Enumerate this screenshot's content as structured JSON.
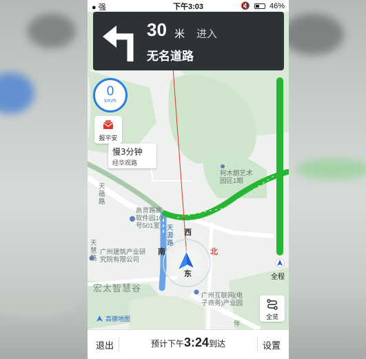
{
  "status_bar": {
    "signal": "强",
    "time": "下午3:03",
    "battery": "46%",
    "battery_level": 0.46
  },
  "guidance": {
    "distance": "30",
    "unit": "米",
    "action": "进入",
    "road": "无名道路",
    "turn_icon": "turn-left-arrow-icon"
  },
  "speed": {
    "value": "0",
    "unit": "km/h"
  },
  "report_safe": {
    "label": "报平安",
    "icon": "envelope-icon"
  },
  "route_bubble": {
    "title": "慢3分钟",
    "subtitle": "经华观路"
  },
  "map_labels": {
    "kemu": "柯木朗艺术\n园区1期",
    "gaopu": "高普路高\n软件园10\n号501室",
    "jianzhu": "广州建筑产业研\n究院有限公司",
    "hongtai": "宏太智慧谷",
    "hulianwang": "广州互联网(电\n子商务)产业园",
    "tiangui": "天\n蕴\n路",
    "tianyuan": "天\n源\n路",
    "tianhui": "天\n慧\n路",
    "ban": "伴"
  },
  "compass": {
    "west": "西",
    "south": "南",
    "east": "东",
    "north": "北"
  },
  "progress": {
    "label": "全程",
    "fraction": 1.0
  },
  "overview": {
    "label": "全览"
  },
  "logo": {
    "text": "高德地图"
  },
  "bottom_bar": {
    "exit": "退出",
    "eta_prefix": "预计下午",
    "eta_time": "3:24",
    "eta_suffix": "到达",
    "settings": "设置"
  },
  "colors": {
    "route_green": "#27b535",
    "accent_blue": "#2a7de1",
    "nav_card": "#2d3236",
    "north_red": "#e23b33"
  }
}
